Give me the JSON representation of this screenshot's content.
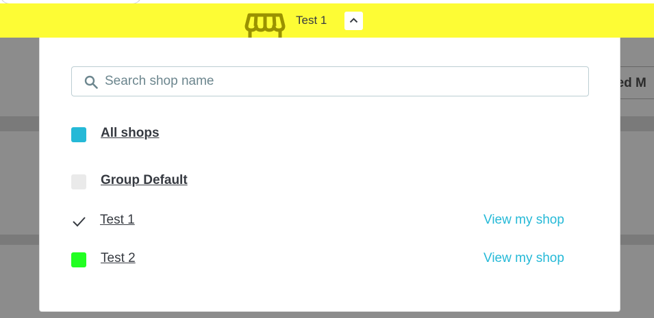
{
  "header": {
    "shop_name": "Test 1",
    "icon": "store-icon",
    "toggle_icon": "chevron-up-icon",
    "bar_color": "#fdfc35"
  },
  "background": {
    "button_fragment": "ded M"
  },
  "dropdown": {
    "search": {
      "placeholder": "Search shop name",
      "value": ""
    },
    "items": [
      {
        "label": "All shops",
        "type": "all",
        "marker": "swatch",
        "color": "#25b9d7"
      },
      {
        "label": "Group Default",
        "type": "group",
        "marker": "swatch",
        "color": "#eaeaea"
      },
      {
        "label": "Test 1",
        "type": "shop",
        "marker": "checkmark-icon",
        "selected": true,
        "action": "View my shop"
      },
      {
        "label": "Test 2",
        "type": "shop",
        "marker": "swatch",
        "color": "#22ff22",
        "action": "View my shop"
      }
    ]
  },
  "colors": {
    "accent": "#25b9d7",
    "text": "#363a41"
  }
}
